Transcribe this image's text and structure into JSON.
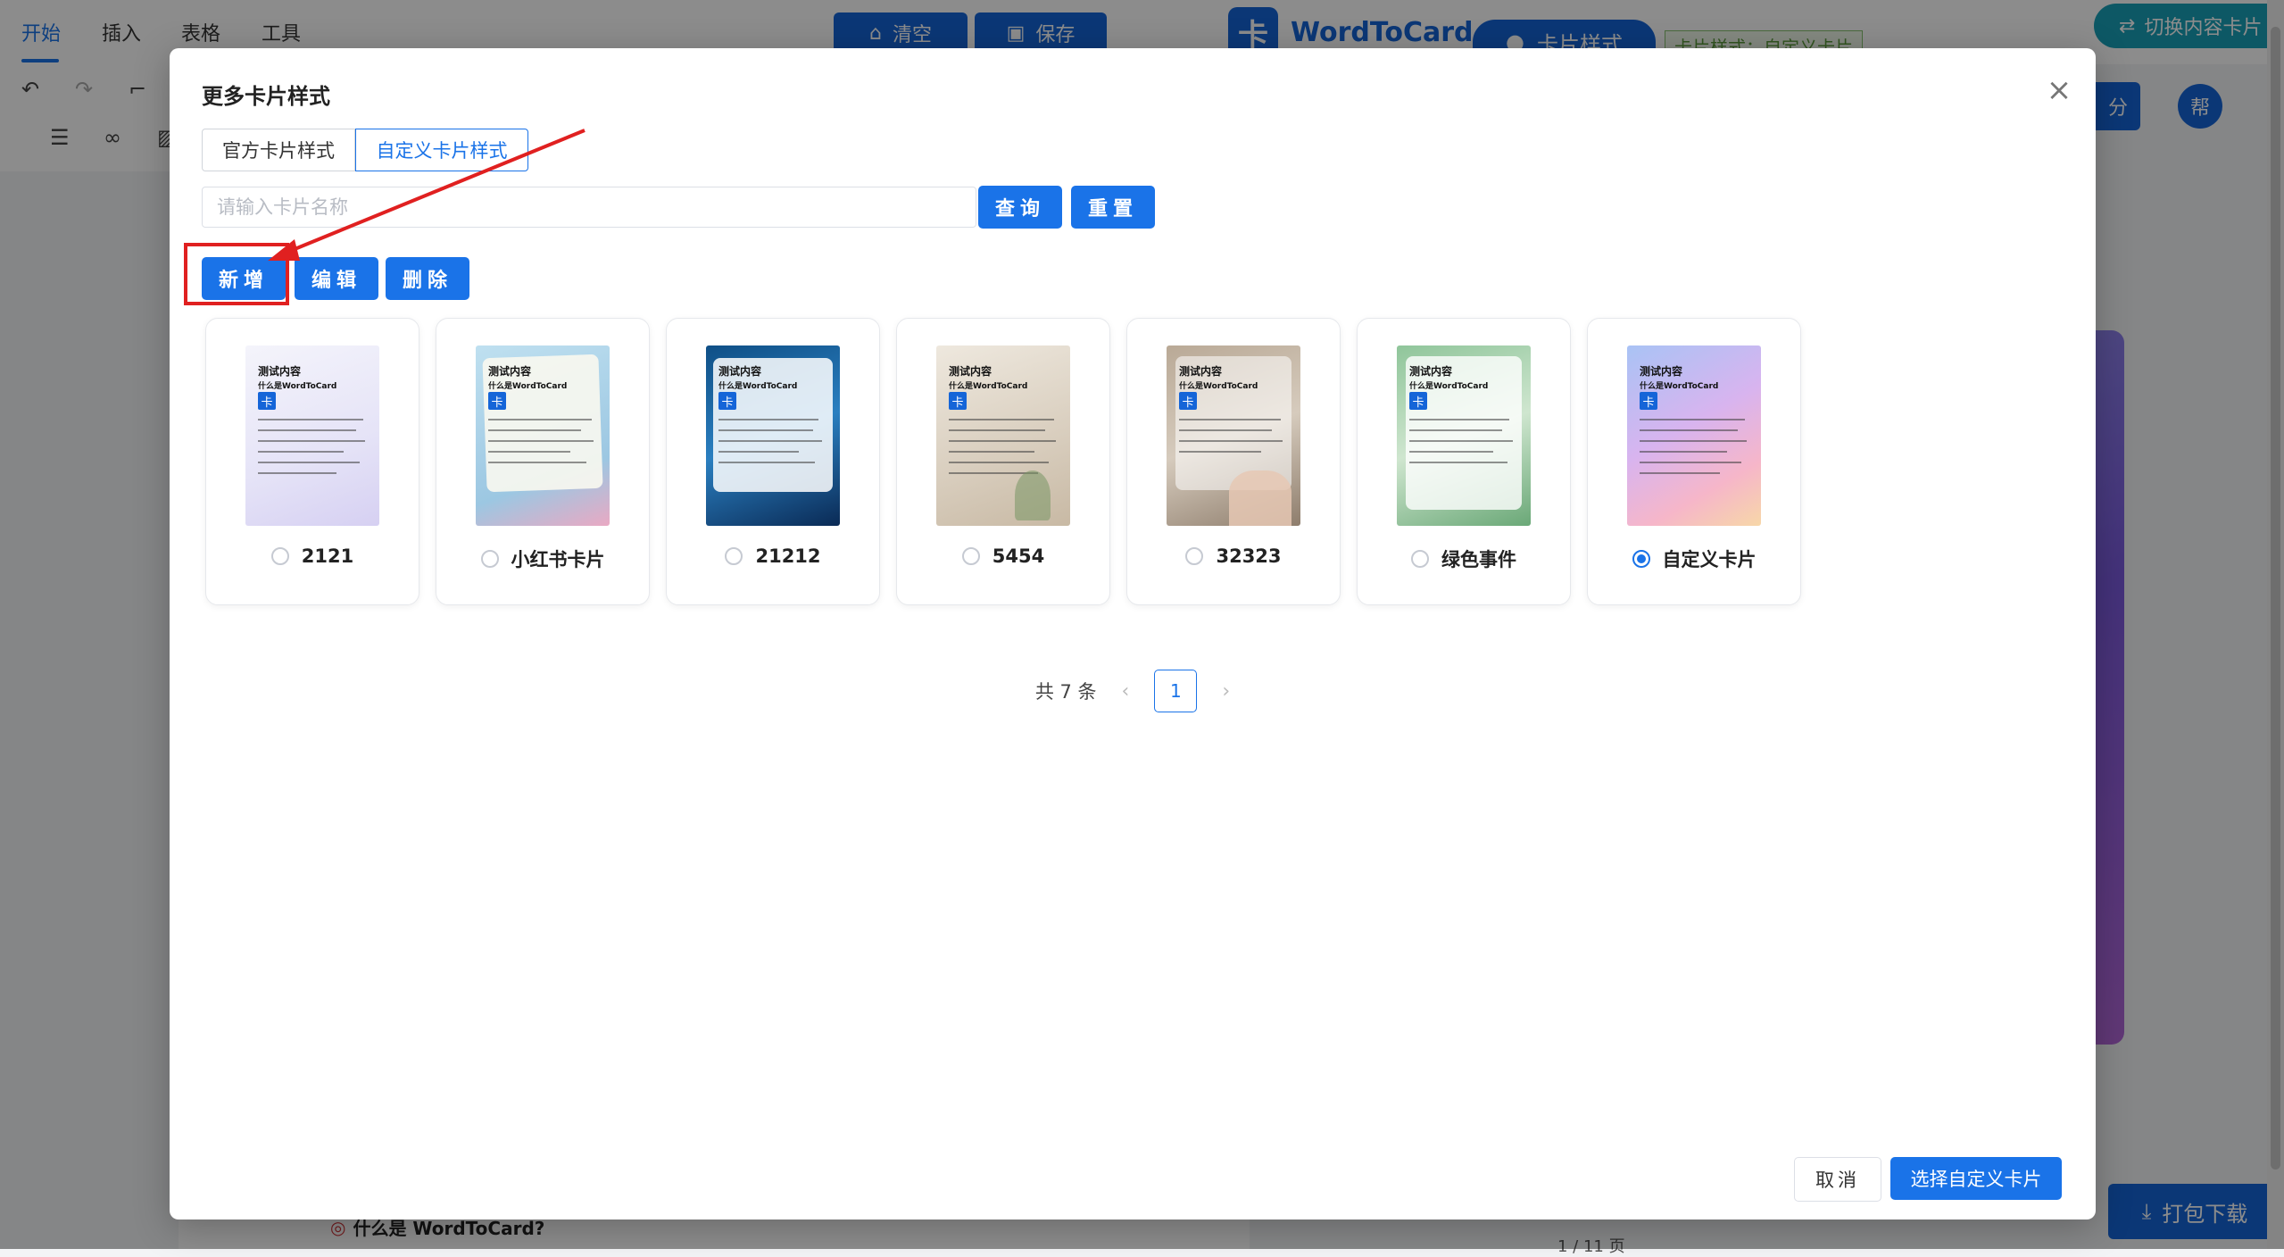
{
  "app": {
    "menu_tabs": [
      "开始",
      "插入",
      "表格",
      "工具"
    ],
    "clear_label": "清空",
    "save_label": "保存",
    "brand_name": "WordToCard",
    "brand_logo_char": "卡",
    "card_style_label": "卡片样式",
    "card_style_tag": "卡片样式：自定义卡片",
    "switch_content_label": "切换内容卡片",
    "score_label": "分",
    "help_label": "帮",
    "pack_download_label": "打包下载",
    "doc_bottom_text": "什么是 WordToCard?",
    "page_info": "1 / 11 页",
    "accent_color": "#1a73e8"
  },
  "modal": {
    "title": "更多卡片样式",
    "tabs": {
      "official": "官方卡片样式",
      "custom": "自定义卡片样式"
    },
    "active_tab": "custom",
    "search": {
      "placeholder": "请输入卡片名称",
      "value": ""
    },
    "buttons": {
      "query": "查询",
      "reset": "重置",
      "add": "新增",
      "edit": "编辑",
      "delete": "删除"
    },
    "cards": [
      {
        "name": "2121",
        "selected": false,
        "theme": "lavender"
      },
      {
        "name": "小红书卡片",
        "selected": false,
        "theme": "paper-blue"
      },
      {
        "name": "21212",
        "selected": false,
        "theme": "deep-blue"
      },
      {
        "name": "5454",
        "selected": false,
        "theme": "beige-plant"
      },
      {
        "name": "32323",
        "selected": false,
        "theme": "glass-hand"
      },
      {
        "name": "绿色事件",
        "selected": false,
        "theme": "green"
      },
      {
        "name": "自定义卡片",
        "selected": true,
        "theme": "pastel-gradient"
      }
    ],
    "thumb_text": {
      "heading": "测试内容",
      "subheading": "什么是WordToCard",
      "logo_char": "卡"
    },
    "pagination": {
      "total_label": "共 7 条",
      "current_page": "1"
    },
    "footer": {
      "cancel": "取消",
      "confirm": "选择自定义卡片"
    }
  }
}
